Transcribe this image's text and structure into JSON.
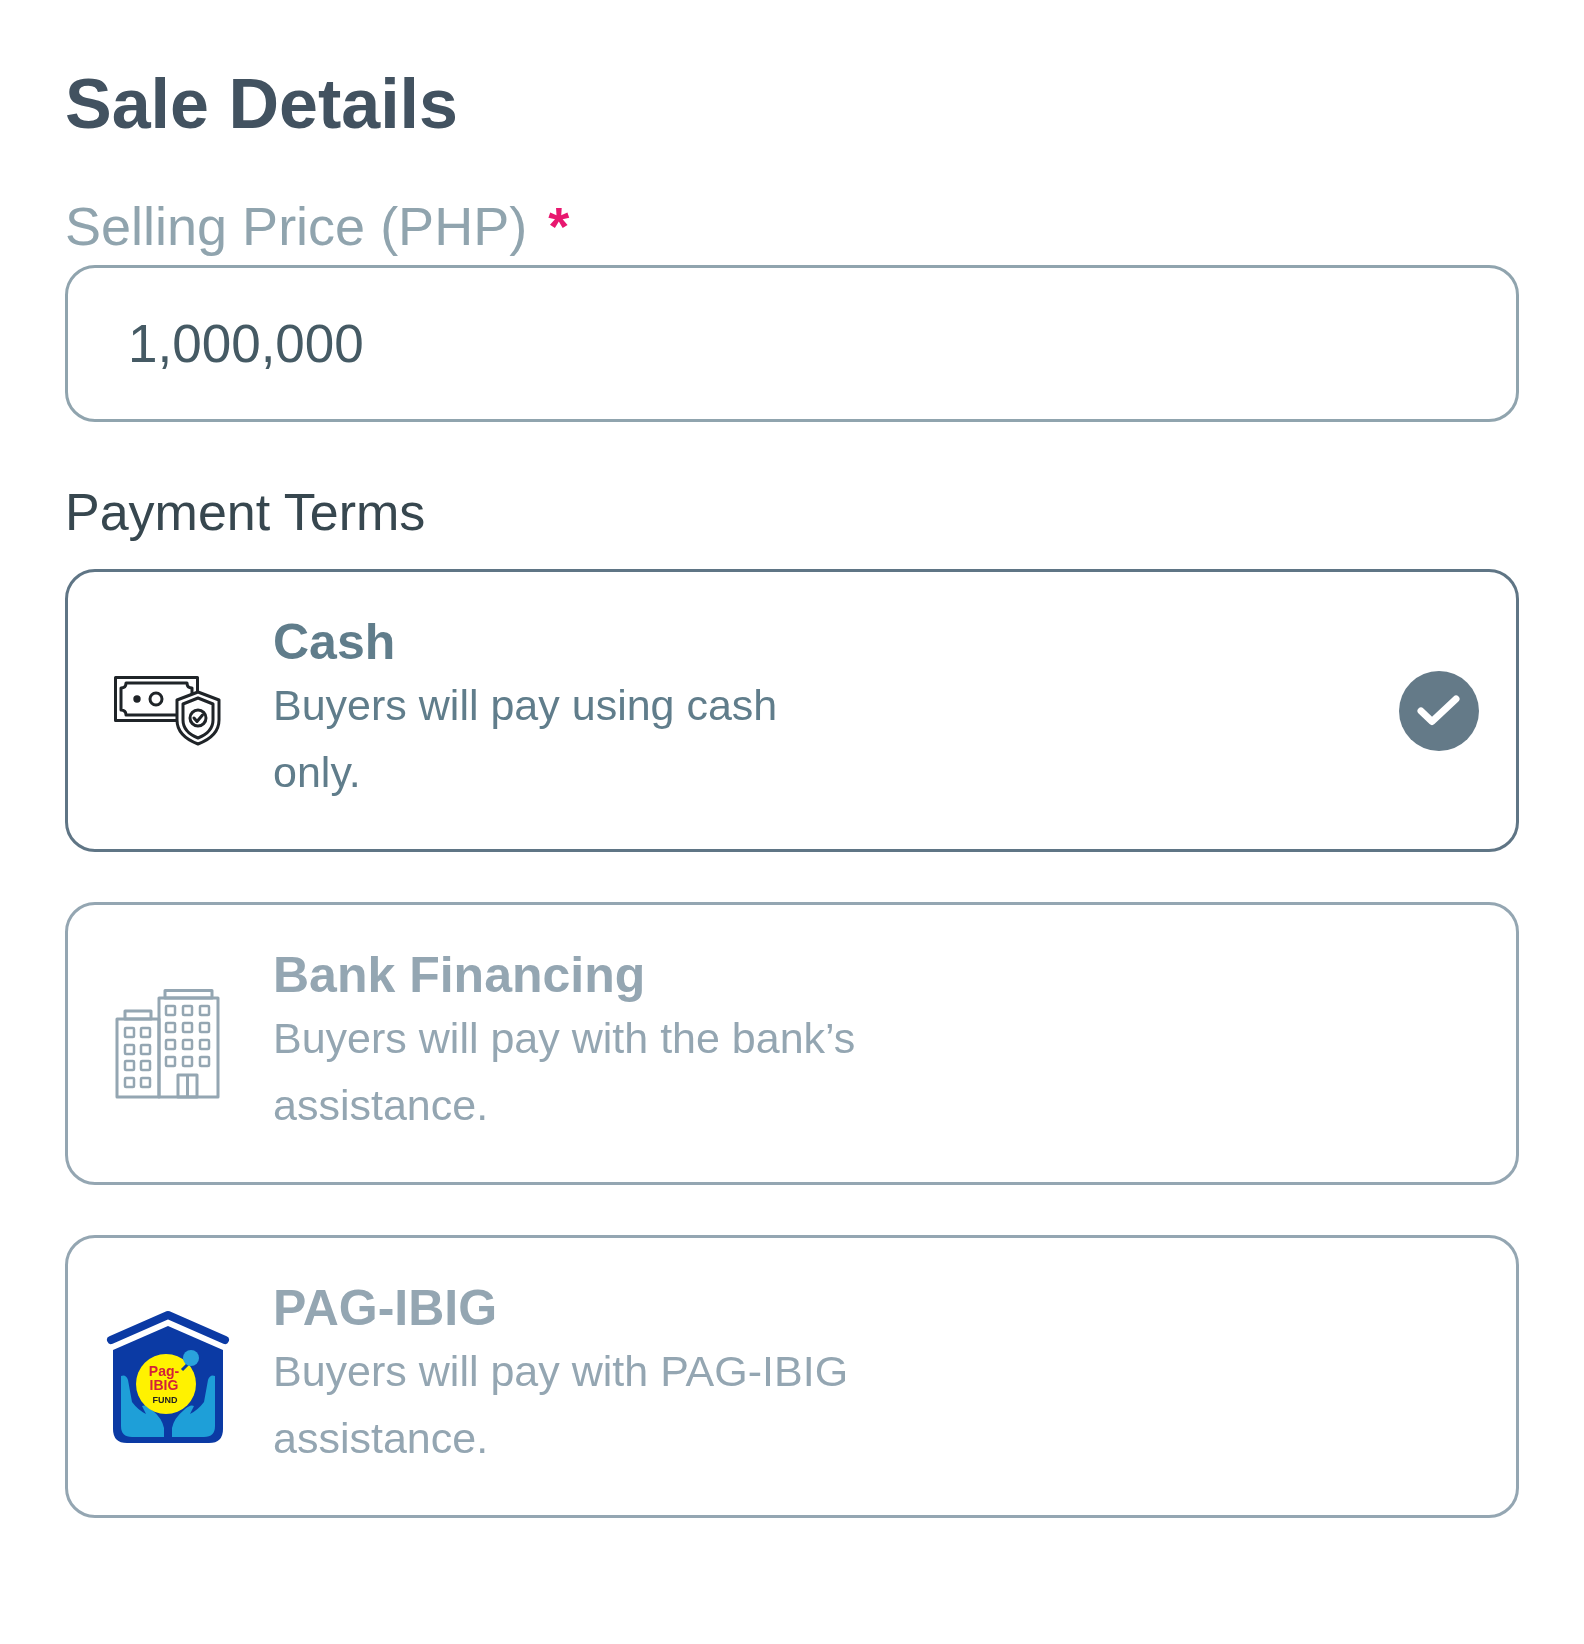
{
  "title": "Sale Details",
  "selling_price": {
    "label": "Selling Price (PHP)",
    "required_mark": "*",
    "value": "1,000,000"
  },
  "payment_terms": {
    "label": "Payment Terms",
    "options": [
      {
        "kind": "cash",
        "title": "Cash",
        "description": "Buyers will pay using cash only.",
        "selected": true
      },
      {
        "kind": "bank",
        "title": "Bank Financing",
        "description": "Buyers will pay with the bank’s assistance.",
        "selected": false
      },
      {
        "kind": "pag-ibig",
        "title": "PAG-IBIG",
        "description": "Buyers will pay with PAG-IBIG assistance.",
        "selected": false,
        "logo_text": [
          "Pag-",
          "IBIG"
        ],
        "logo_caption": "FUND"
      }
    ]
  }
}
